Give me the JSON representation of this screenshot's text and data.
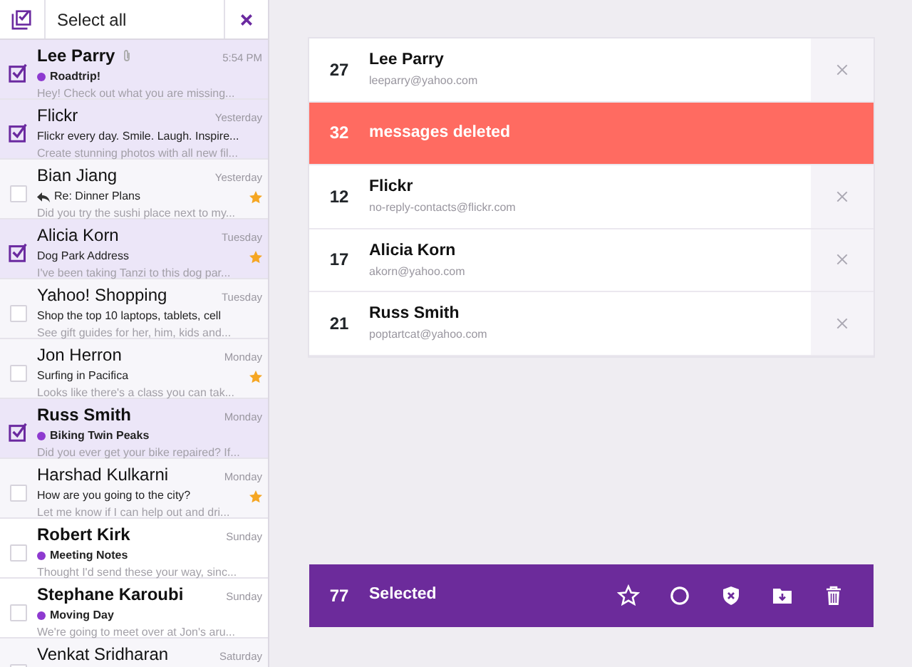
{
  "toolbar": {
    "select_all": "Select all"
  },
  "messages": [
    {
      "name": "Lee Parry",
      "time": "5:54 PM",
      "subject": "Roadtrip!",
      "preview": "Hey! Check out what you are missing...",
      "selected": true,
      "unread": true,
      "starred": false,
      "replied": false,
      "attachment": true
    },
    {
      "name": "Flickr",
      "time": "Yesterday",
      "subject": "Flickr every day. Smile. Laugh. Inspire...",
      "preview": "Create stunning photos with all new fil...",
      "selected": true,
      "unread": false,
      "starred": false,
      "replied": false,
      "attachment": false
    },
    {
      "name": "Bian Jiang",
      "time": "Yesterday",
      "subject": "Re: Dinner Plans",
      "preview": "Did you try the sushi place next to my...",
      "selected": false,
      "unread": false,
      "starred": true,
      "replied": true,
      "attachment": false
    },
    {
      "name": "Alicia Korn",
      "time": "Tuesday",
      "subject": "Dog Park Address",
      "preview": "I've been taking Tanzi to this dog par...",
      "selected": true,
      "unread": false,
      "starred": true,
      "replied": false,
      "attachment": false
    },
    {
      "name": "Yahoo! Shopping",
      "time": "Tuesday",
      "subject": "Shop the top 10 laptops, tablets, cell",
      "preview": "See gift guides for her, him, kids and...",
      "selected": false,
      "unread": false,
      "starred": false,
      "replied": false,
      "attachment": false
    },
    {
      "name": "Jon Herron",
      "time": "Monday",
      "subject": "Surfing in Pacifica",
      "preview": "Looks like there's a class you can tak...",
      "selected": false,
      "unread": false,
      "starred": true,
      "replied": false,
      "attachment": false
    },
    {
      "name": "Russ Smith",
      "time": "Monday",
      "subject": "Biking Twin Peaks",
      "preview": "Did you ever get your bike repaired? If...",
      "selected": true,
      "unread": true,
      "starred": false,
      "replied": false,
      "attachment": false
    },
    {
      "name": "Harshad Kulkarni",
      "time": "Monday",
      "subject": "How are you going to the city?",
      "preview": "Let me know if I can help out and dri...",
      "selected": false,
      "unread": false,
      "starred": true,
      "replied": false,
      "attachment": false
    },
    {
      "name": "Robert Kirk",
      "time": "Sunday",
      "subject": "Meeting Notes",
      "preview": "Thought I'd send these your way, sinc...",
      "selected": false,
      "unread": true,
      "starred": false,
      "replied": false,
      "attachment": false
    },
    {
      "name": "Stephane Karoubi",
      "time": "Sunday",
      "subject": "Moving Day",
      "preview": "We're going to meet over at Jon's aru...",
      "selected": false,
      "unread": true,
      "starred": false,
      "replied": false,
      "attachment": false
    },
    {
      "name": "Venkat Sridharan",
      "time": "Saturday",
      "selected": false,
      "unread": false,
      "attachment": false
    }
  ],
  "senders": [
    {
      "kind": "sender",
      "count": "27",
      "name": "Lee Parry",
      "email": "leeparry@yahoo.com"
    },
    {
      "kind": "deleted",
      "count": "32",
      "name": "messages deleted"
    },
    {
      "kind": "sender",
      "count": "12",
      "name": "Flickr",
      "email": "no-reply-contacts@flickr.com"
    },
    {
      "kind": "sender",
      "count": "17",
      "name": "Alicia Korn",
      "email": "akorn@yahoo.com"
    },
    {
      "kind": "sender",
      "count": "21",
      "name": "Russ Smith",
      "email": "poptartcat@yahoo.com"
    }
  ],
  "action_bar": {
    "count": "77",
    "label": "Selected"
  }
}
